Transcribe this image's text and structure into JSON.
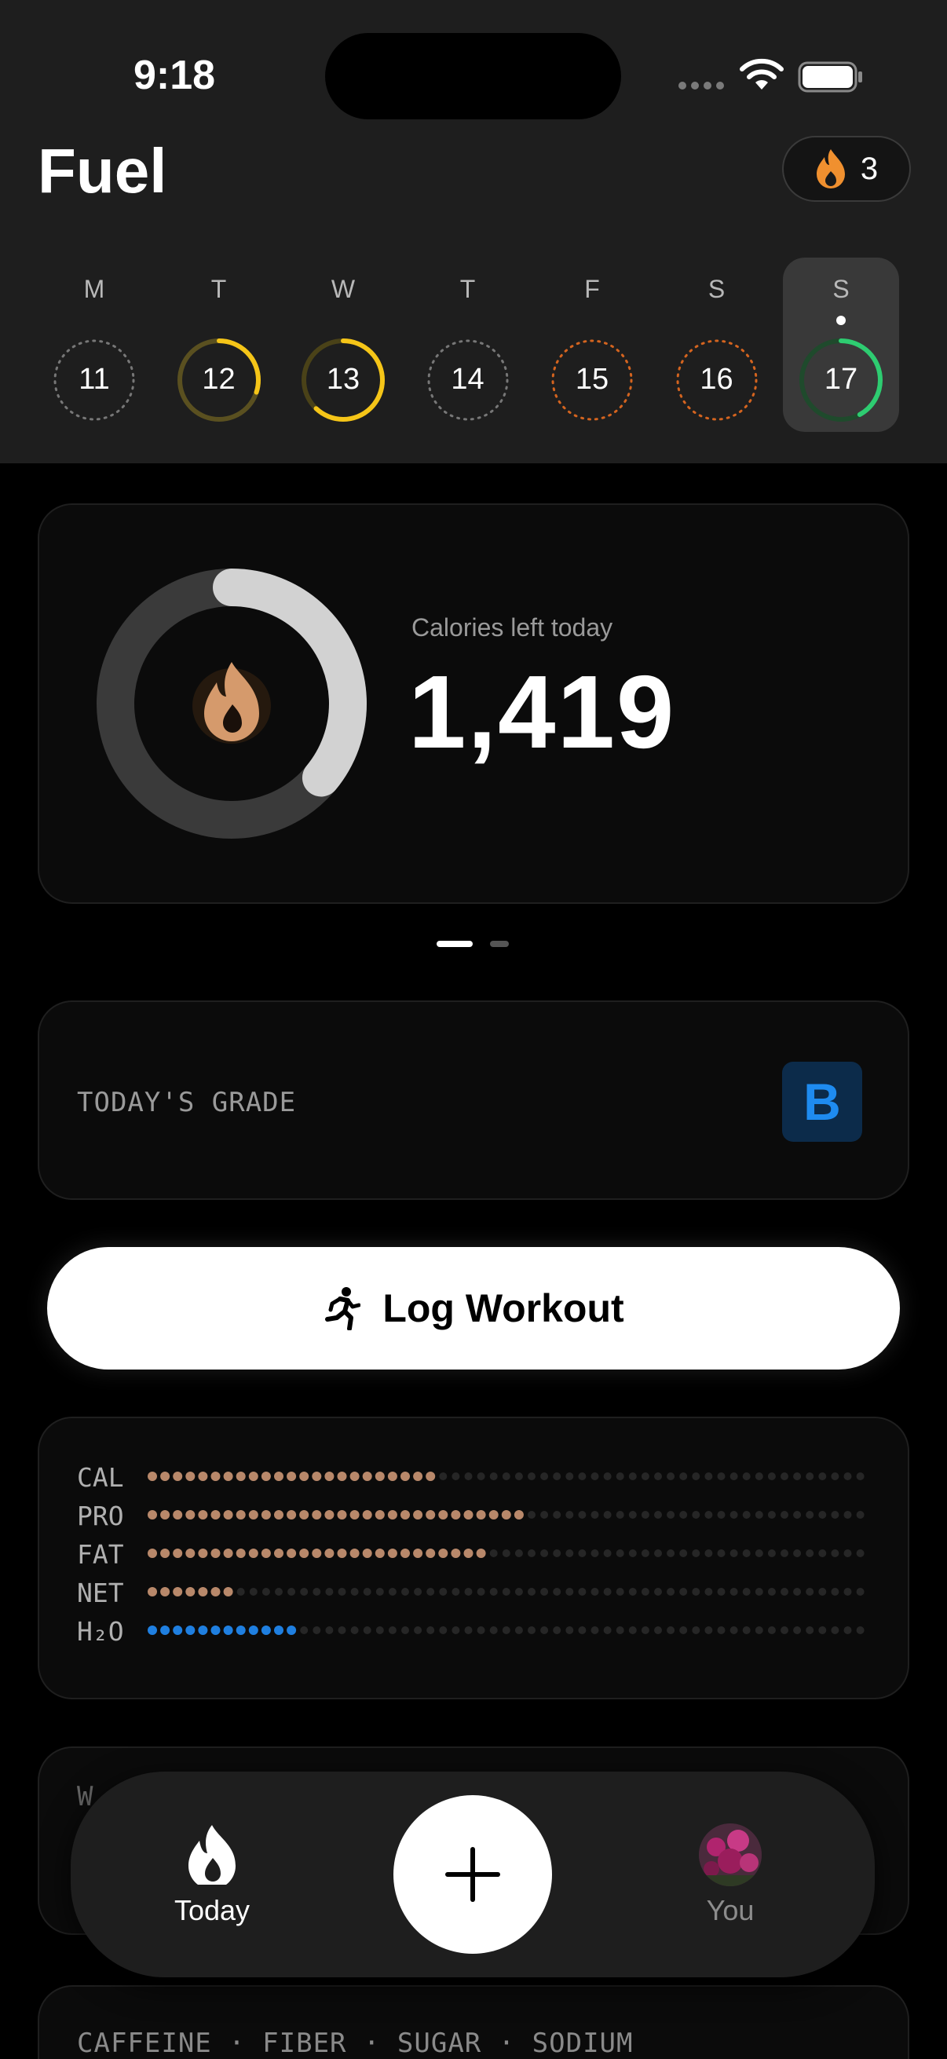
{
  "status_bar": {
    "time": "9:18"
  },
  "app": {
    "title": "Fuel"
  },
  "streak": {
    "count": "3"
  },
  "week": [
    {
      "letter": "M",
      "date": "11",
      "progress": 0,
      "style": "dashed-gray",
      "selected": false
    },
    {
      "letter": "T",
      "date": "12",
      "progress": 0.3,
      "style": "yellow-partial",
      "selected": false
    },
    {
      "letter": "W",
      "date": "13",
      "progress": 0.62,
      "style": "yellow",
      "selected": false
    },
    {
      "letter": "T",
      "date": "14",
      "progress": 0,
      "style": "dashed-gray",
      "selected": false
    },
    {
      "letter": "F",
      "date": "15",
      "progress": 0,
      "style": "dashed-orange",
      "selected": false
    },
    {
      "letter": "S",
      "date": "16",
      "progress": 0,
      "style": "dashed-orange",
      "selected": false
    },
    {
      "letter": "S",
      "date": "17",
      "progress": 0.42,
      "style": "green",
      "selected": true
    }
  ],
  "calories": {
    "label": "Calories left today",
    "value": "1,419",
    "ring_progress": 0.36
  },
  "pager": {
    "pages": 2,
    "active": 0
  },
  "grade": {
    "label": "TODAY'S GRADE",
    "value": "B"
  },
  "log_workout": {
    "label": "Log Workout"
  },
  "macros": [
    {
      "label": "CAL",
      "filled": 23,
      "total": 57,
      "color": "#b8886a"
    },
    {
      "label": "PRO",
      "filled": 30,
      "total": 57,
      "color": "#b8886a"
    },
    {
      "label": "FAT",
      "filled": 27,
      "total": 57,
      "color": "#b8886a"
    },
    {
      "label": "NET",
      "filled": 7,
      "total": 57,
      "color": "#b8886a"
    },
    {
      "label": "H₂O",
      "filled": 12,
      "total": 57,
      "color": "#1f7fe0"
    }
  ],
  "micro_card_partial": {
    "title": "W"
  },
  "micronutrients": {
    "title": "CAFFEINE · FIBER · SUGAR · SODIUM"
  },
  "tabbar": {
    "today": "Today",
    "you": "You"
  },
  "colors": {
    "accent_flame": "#e8862a",
    "ring_track": "#3a3a3a",
    "ring_fill": "#d0d0d0",
    "grade_blue": "#1e8bf0",
    "green": "#2ecc71",
    "yellow": "#f5c518"
  }
}
